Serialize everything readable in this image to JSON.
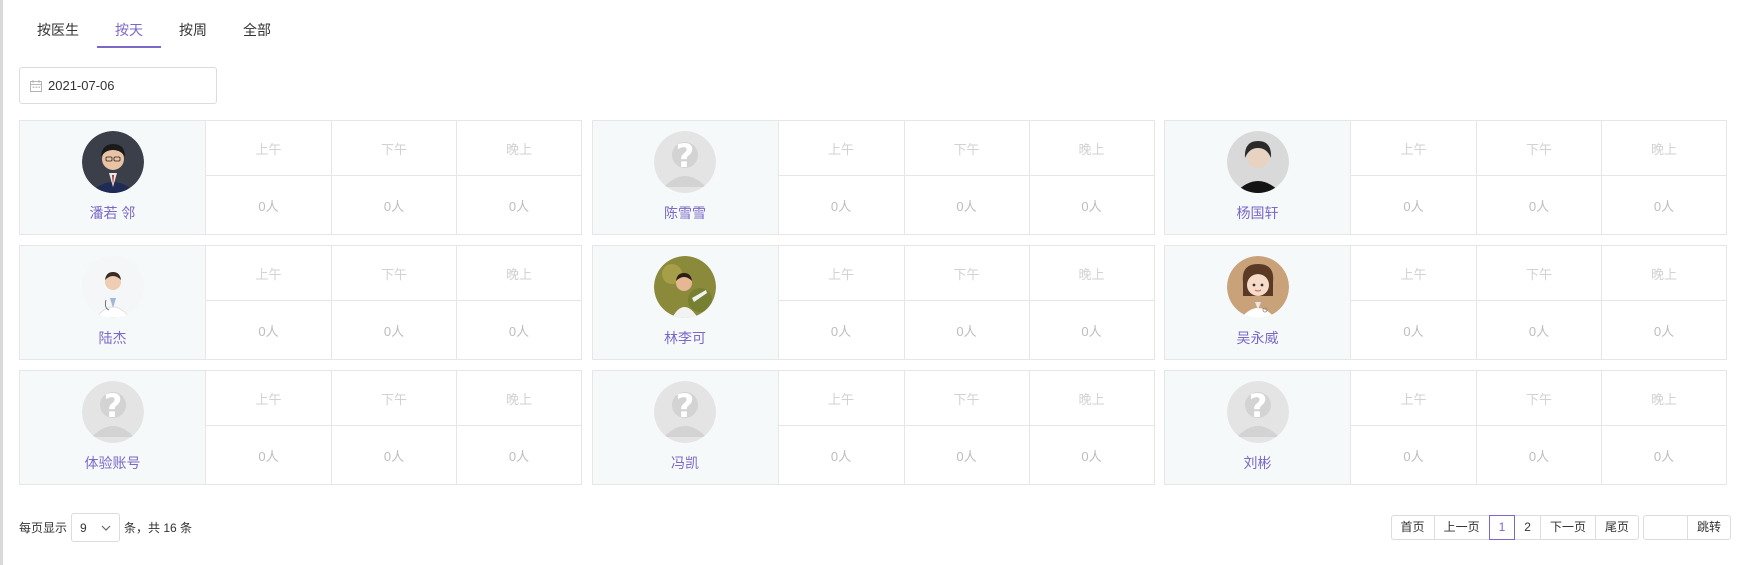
{
  "tabs": [
    {
      "label": "按医生",
      "active": false
    },
    {
      "label": "按天",
      "active": true
    },
    {
      "label": "按周",
      "active": false
    },
    {
      "label": "全部",
      "active": false
    }
  ],
  "date_picker": {
    "value": "2021-07-06",
    "icon": "calendar-icon"
  },
  "slot_headers": [
    "上午",
    "下午",
    "晚上"
  ],
  "doctors": [
    {
      "name": "潘若 邻",
      "avatar": "photo-suit-man",
      "counts": [
        "0人",
        "0人",
        "0人"
      ]
    },
    {
      "name": "陈雪雪",
      "avatar": "placeholder",
      "counts": [
        "0人",
        "0人",
        "0人"
      ]
    },
    {
      "name": "杨国轩",
      "avatar": "photo-man-dark",
      "counts": [
        "0人",
        "0人",
        "0人"
      ]
    },
    {
      "name": "陆杰",
      "avatar": "photo-white-coat",
      "counts": [
        "0人",
        "0人",
        "0人"
      ]
    },
    {
      "name": "林李可",
      "avatar": "photo-child",
      "counts": [
        "0人",
        "0人",
        "0人"
      ]
    },
    {
      "name": "吴永威",
      "avatar": "cartoon-doctor",
      "counts": [
        "0人",
        "0人",
        "0人"
      ]
    },
    {
      "name": "体验账号",
      "avatar": "placeholder",
      "counts": [
        "0人",
        "0人",
        "0人"
      ]
    },
    {
      "name": "冯凯",
      "avatar": "placeholder",
      "counts": [
        "0人",
        "0人",
        "0人"
      ]
    },
    {
      "name": "刘彬",
      "avatar": "placeholder",
      "counts": [
        "0人",
        "0人",
        "0人"
      ]
    }
  ],
  "pagination": {
    "per_page_label": "每页显示",
    "per_page_value": "9",
    "total_text": "条，共 16 条",
    "first": "首页",
    "prev": "上一页",
    "pages": [
      "1",
      "2"
    ],
    "current_page": "1",
    "next": "下一页",
    "last": "尾页",
    "jump": "跳转"
  },
  "colors": {
    "accent": "#7b68c8",
    "doc_bg": "#f5f9fa",
    "border": "#e6e6e6"
  }
}
